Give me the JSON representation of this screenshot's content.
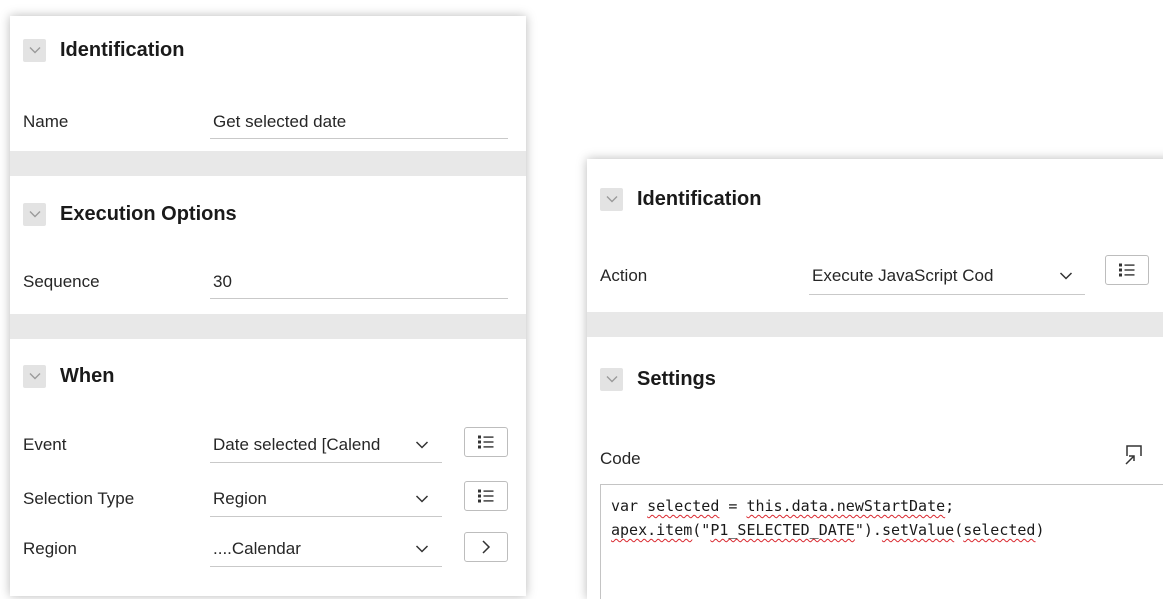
{
  "left_panel": {
    "identification": {
      "title": "Identification",
      "name_label": "Name",
      "name_value": "Get selected date"
    },
    "execution_options": {
      "title": "Execution Options",
      "sequence_label": "Sequence",
      "sequence_value": "30"
    },
    "when": {
      "title": "When",
      "event_label": "Event",
      "event_value": "Date selected [Calend",
      "selection_type_label": "Selection Type",
      "selection_type_value": "Region",
      "region_label": "Region",
      "region_value": "....Calendar"
    }
  },
  "right_panel": {
    "identification": {
      "title": "Identification",
      "action_label": "Action",
      "action_value": "Execute JavaScript Cod"
    },
    "settings": {
      "title": "Settings",
      "code_label": "Code",
      "code": {
        "line1": {
          "kw": "var ",
          "var": "selected",
          "rest": " = ",
          "expr": "this.data.newStartDate",
          "end": ";"
        },
        "line2": {
          "fn": "apex.item",
          "p1": "(\"",
          "str": "P1_SELECTED_DATE",
          "p2": "\").",
          "method": "setValue",
          "p3": "(",
          "arg": "selected",
          "p4": ")"
        }
      }
    }
  }
}
